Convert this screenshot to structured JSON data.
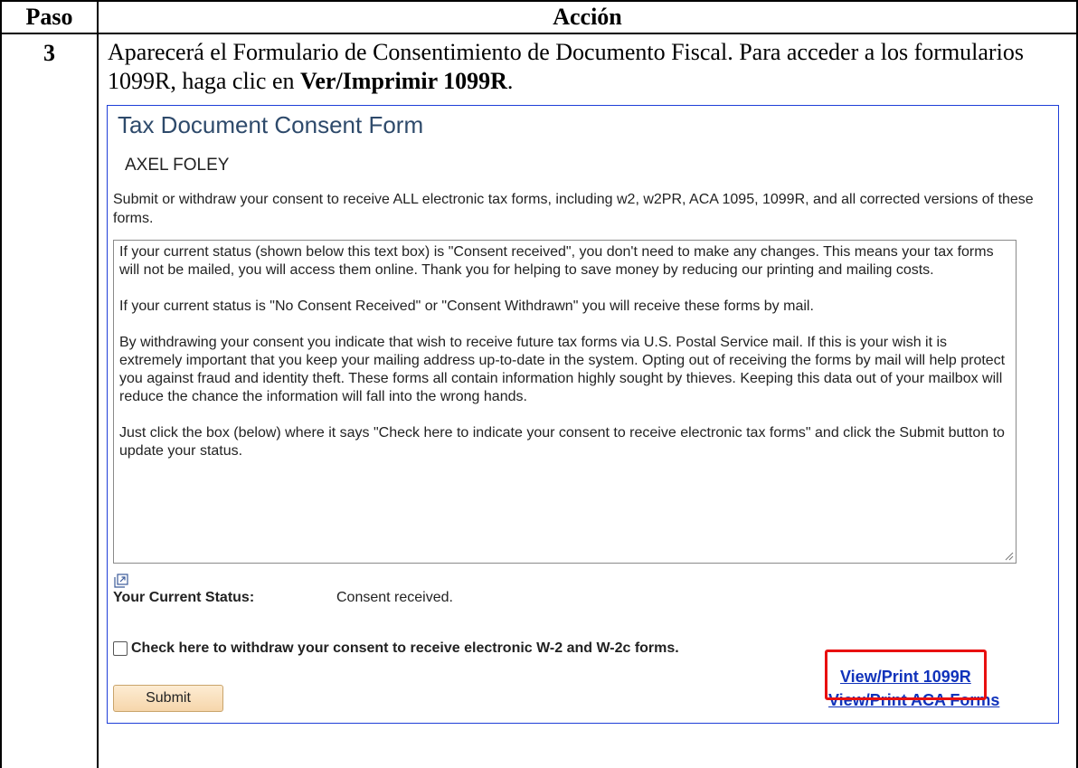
{
  "table": {
    "headers": [
      "Paso",
      "Acción"
    ],
    "step_number": "3",
    "instruction_prefix": "Aparecerá el Formulario de Consentimiento de Documento Fiscal.  Para acceder a los formularios 1099R, haga clic en ",
    "instruction_bold": "Ver/Imprimir 1099R",
    "instruction_suffix": "."
  },
  "screenshot": {
    "title": "Tax Document Consent Form",
    "employee_name": "AXEL FOLEY",
    "intro": "Submit or withdraw your consent to receive ALL electronic tax forms, including w2, w2PR, ACA 1095, 1099R, and all corrected versions of these forms.",
    "consent_paragraphs": [
      "If your current status (shown below this text box) is \"Consent received\", you don't need to make any changes. This means your tax forms will not be mailed, you will access them online. Thank you for helping to save money by reducing our printing and mailing costs.",
      "If your current status is \"No Consent Received\" or  \"Consent Withdrawn\" you will  receive these forms by mail.",
      "By withdrawing your consent you indicate that wish to receive future tax forms via U.S. Postal Service mail. If this is your wish it is extremely important that you keep your mailing address up-to-date in the system. Opting out of receiving the forms by mail will help protect you against fraud and identity theft. These forms all contain information highly sought by thieves. Keeping this data out of your mailbox will reduce the chance the information will fall into the wrong hands.",
      "Just click the box (below) where it says \"Check here to indicate your consent to receive electronic tax forms\" and click the Submit button to update your status."
    ],
    "status_label": "Your Current Status:",
    "status_value": "Consent received.",
    "withdraw_label": "Check here to withdraw your consent to receive electronic W-2 and W-2c forms.",
    "withdraw_checked": false,
    "submit_label": "Submit",
    "link_1099r": "View/Print 1099R",
    "link_aca": "View/Print ACA Forms",
    "icons": {
      "popout": "popout-icon",
      "resize": "resize-grip-icon"
    },
    "colors": {
      "frame_border": "#1f3fd8",
      "link": "#1133bb",
      "highlight": "#e81010",
      "title": "#2e4a6b"
    }
  }
}
